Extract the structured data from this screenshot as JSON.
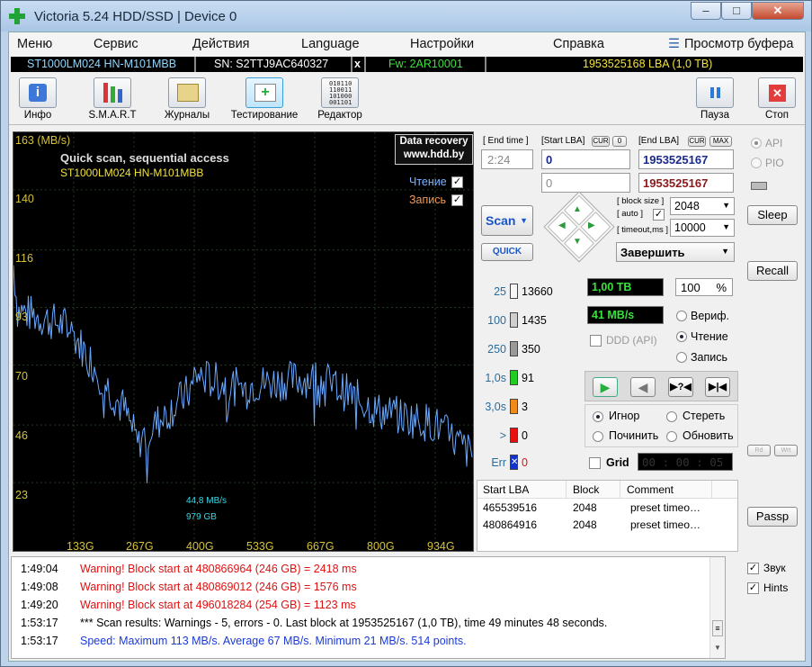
{
  "window": {
    "title": "Victoria 5.24 HDD/SSD | Device 0",
    "controls": [
      "–",
      "□",
      "✕"
    ]
  },
  "menu": {
    "items": [
      "Меню",
      "Сервис",
      "Действия",
      "Language",
      "Настройки",
      "Справка",
      "Просмотр буфера"
    ]
  },
  "info": {
    "model": "ST1000LM024 HN-M101MBB",
    "sn": "SN: S2TTJ9AC640327",
    "x": "x",
    "fw": "Fw: 2AR10001",
    "lba": "1953525168 LBA (1,0 TB)"
  },
  "toolbar": {
    "info": "Инфо",
    "smart": "S.M.A.R.T",
    "logs": "Журналы",
    "test": "Тестирование",
    "editor": "Редактор",
    "pause": "Пауза",
    "stop": "Стоп"
  },
  "graph": {
    "unit": "163 (MB/s)",
    "title": "Quick scan, sequential access",
    "model": "ST1000LM024 HN-M101MBB",
    "recovery1": "Data recovery",
    "recovery2": "www.hdd.by",
    "read_label": "Чтение",
    "write_label": "Запись",
    "speed_note": "44,8 MB/s",
    "pos_note": "979 GB",
    "y_ticks": [
      "140",
      "116",
      "93",
      "70",
      "46",
      "23"
    ],
    "x_ticks": [
      "133G",
      "267G",
      "400G",
      "533G",
      "667G",
      "800G",
      "934G"
    ],
    "line_color": "#6aa9ff"
  },
  "controls": {
    "end_time_label": "[ End time ]",
    "end_time": "2:24",
    "start_lba_label": "[Start LBA]",
    "cur": "CUR",
    "zero": "0",
    "end_lba_label": "[End LBA]",
    "max": "MAX",
    "start_lba": "0",
    "end_lba": "1953525167",
    "start_lba2": "0",
    "end_lba2": "1953525167",
    "scan": "Scan",
    "quick": "QUICK",
    "block_size_label": "[ block size ]",
    "auto_label": "[ auto ]",
    "block_size": "2048",
    "timeout_label": "[ timeout,ms ]",
    "timeout": "10000",
    "finish": "Завершить"
  },
  "stats": {
    "blocks": [
      {
        "label": "25",
        "count": "13660",
        "color": "#f6f6f6"
      },
      {
        "label": "100",
        "count": "1435",
        "color": "#cfcfcf"
      },
      {
        "label": "250",
        "count": "350",
        "color": "#9a9a9a"
      },
      {
        "label": "1,0s",
        "count": "91",
        "color": "#22cc22"
      },
      {
        "label": "3,0s",
        "count": "3",
        "color": "#f28a1a"
      },
      {
        "label": ">",
        "count": "0",
        "color": "#e81010"
      },
      {
        "label": "Err",
        "count": "0",
        "color": "#1133cc"
      }
    ],
    "size": "1,00 TB",
    "percent": "100",
    "percent_sign": "%",
    "speed": "41 MB/s",
    "ddd": "DDD (API)",
    "verify": "Вериф.",
    "read": "Чтение",
    "write": "Запись",
    "ignore": "Игнор",
    "erase": "Стереть",
    "repair": "Починить",
    "refresh": "Обновить",
    "grid": "Grid",
    "timer": "00 : 00 : 05"
  },
  "table": {
    "headers": [
      "Start LBA",
      "Block",
      "Comment"
    ],
    "rows": [
      [
        "465539516",
        "2048",
        "preset timeo…"
      ],
      [
        "480864916",
        "2048",
        "preset timeo…"
      ]
    ]
  },
  "side": {
    "api": "API",
    "pio": "PIO",
    "sleep": "Sleep",
    "recall": "Recall",
    "rd": "Rd",
    "wrt": "Wrt",
    "passp": "Passp",
    "sound": "Звук",
    "hints": "Hints"
  },
  "log": [
    {
      "time": "1:49:04",
      "msg": "Warning! Block start at 480866964 (246 GB)  = 2418 ms",
      "color": "#e01010"
    },
    {
      "time": "1:49:08",
      "msg": "Warning! Block start at 480869012 (246 GB)  = 1576 ms",
      "color": "#e01010"
    },
    {
      "time": "1:49:20",
      "msg": "Warning! Block start at 496018284 (254 GB)  = 1123 ms",
      "color": "#e01010"
    },
    {
      "time": "1:53:17",
      "msg": "*** Scan results: Warnings - 5, errors - 0. Last block at 1953525167 (1,0 TB), time 49 minutes 48 seconds.",
      "color": "#000000"
    },
    {
      "time": "1:53:17",
      "msg": "Speed: Maximum 113 MB/s. Average 67 MB/s. Minimum 21 MB/s. 514 points.",
      "color": "#1a3ad8"
    }
  ]
}
